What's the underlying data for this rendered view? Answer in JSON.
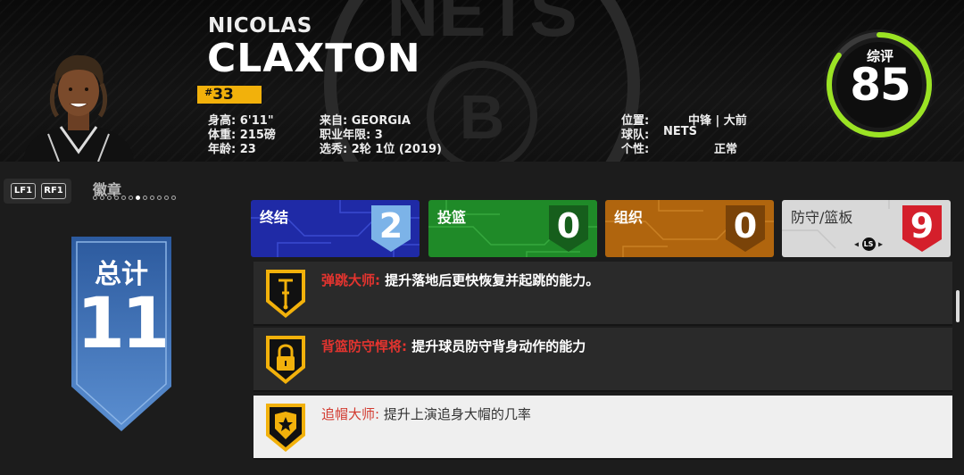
{
  "player": {
    "first_name": "NICOLAS",
    "last_name": "CLAXTON",
    "jersey_hash": "#",
    "jersey_number": "33",
    "height": "身高: 6'11\"",
    "weight": "体重: 215磅",
    "age": "年龄: 23",
    "from": "来自: GEORGIA",
    "experience": "职业年限: 3",
    "draft": "选秀: 2轮 1位 (2019)",
    "position_label": "位置:",
    "position_value": "中锋 | 大前",
    "team_label": "球队:",
    "team_value": "NETS",
    "personality_label": "个性:",
    "personality_value": "正常",
    "overall_label": "综评",
    "overall_value": "85",
    "overall_fraction": 0.85
  },
  "badges_header": {
    "lb_label": "LF1",
    "rb_label": "RF1",
    "title": "徽章",
    "page_count": 12,
    "active_page": 6
  },
  "total": {
    "label": "总计",
    "value": "11"
  },
  "categories": [
    {
      "label": "终结",
      "count": "2"
    },
    {
      "label": "投篮",
      "count": "0"
    },
    {
      "label": "组织",
      "count": "0"
    },
    {
      "label": "防守/篮板",
      "count": "9"
    }
  ],
  "ls_hint": "LS",
  "badge_items": [
    {
      "name": "弹跳大师:",
      "desc": " 提升落地后更快恢复并起跳的能力。",
      "icon": "pogo-stick-icon"
    },
    {
      "name": "背篮防守悍将:",
      "desc": " 提升球员防守背身动作的能力",
      "icon": "padlock-icon"
    },
    {
      "name": "追帽大师:",
      "desc": " 提升上演追身大帽的几率",
      "icon": "star-shield-icon"
    }
  ],
  "colors": {
    "gold": "#f2b10b",
    "finishing": "#1f2aa6",
    "shooting": "#1f8a28",
    "playmaking": "#b0650e",
    "defense": "#d8d8d8",
    "ring_green": "#9be324",
    "badge_name_red": "#e3342f"
  }
}
